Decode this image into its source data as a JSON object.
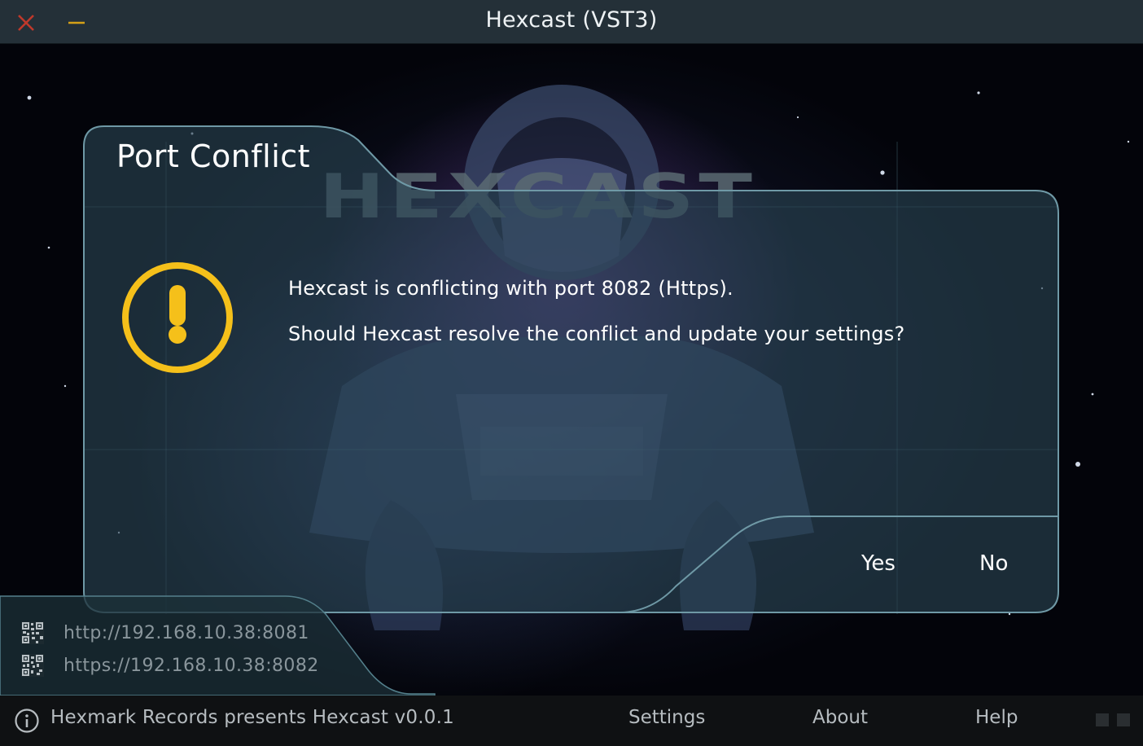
{
  "window": {
    "title": "Hexcast (VST3)"
  },
  "branding": {
    "logo_text": "HEXCAST"
  },
  "dialog": {
    "title": "Port Conflict",
    "icon": "warning-exclamation-icon",
    "message_line1": "Hexcast is conflicting with port 8082 (Https).",
    "message_line2": "Should Hexcast resolve the conflict and update your settings?",
    "yes_label": "Yes",
    "no_label": "No"
  },
  "urls": [
    {
      "icon": "qr-code-icon",
      "text": "http://192.168.10.38:8081"
    },
    {
      "icon": "qr-code-icon",
      "text": "https://192.168.10.38:8082"
    }
  ],
  "footer": {
    "status": "Hexmark Records presents Hexcast v0.0.1",
    "links": {
      "settings": "Settings",
      "about": "About",
      "help": "Help"
    }
  },
  "colors": {
    "titlebar": "#243038",
    "warning": "#f5c01a",
    "close": "#c0392b",
    "minimize": "#d4a017",
    "dialog_fill": "#2a4654",
    "dialog_border": "#6f99a6"
  }
}
